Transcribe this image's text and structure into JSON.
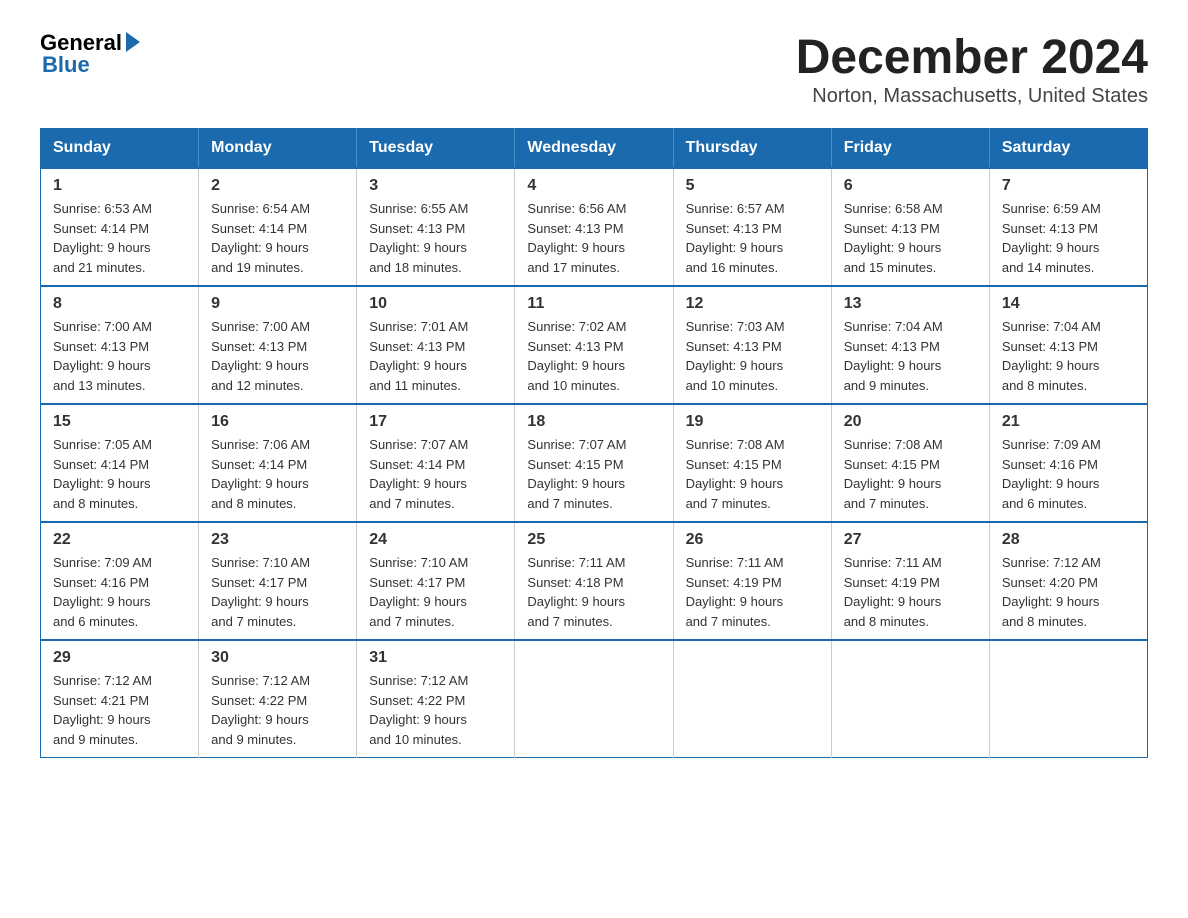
{
  "logo": {
    "general": "General",
    "blue": "Blue"
  },
  "title": "December 2024",
  "subtitle": "Norton, Massachusetts, United States",
  "weekdays": [
    "Sunday",
    "Monday",
    "Tuesday",
    "Wednesday",
    "Thursday",
    "Friday",
    "Saturday"
  ],
  "weeks": [
    [
      {
        "day": "1",
        "sunrise": "6:53 AM",
        "sunset": "4:14 PM",
        "daylight": "9 hours and 21 minutes."
      },
      {
        "day": "2",
        "sunrise": "6:54 AM",
        "sunset": "4:14 PM",
        "daylight": "9 hours and 19 minutes."
      },
      {
        "day": "3",
        "sunrise": "6:55 AM",
        "sunset": "4:13 PM",
        "daylight": "9 hours and 18 minutes."
      },
      {
        "day": "4",
        "sunrise": "6:56 AM",
        "sunset": "4:13 PM",
        "daylight": "9 hours and 17 minutes."
      },
      {
        "day": "5",
        "sunrise": "6:57 AM",
        "sunset": "4:13 PM",
        "daylight": "9 hours and 16 minutes."
      },
      {
        "day": "6",
        "sunrise": "6:58 AM",
        "sunset": "4:13 PM",
        "daylight": "9 hours and 15 minutes."
      },
      {
        "day": "7",
        "sunrise": "6:59 AM",
        "sunset": "4:13 PM",
        "daylight": "9 hours and 14 minutes."
      }
    ],
    [
      {
        "day": "8",
        "sunrise": "7:00 AM",
        "sunset": "4:13 PM",
        "daylight": "9 hours and 13 minutes."
      },
      {
        "day": "9",
        "sunrise": "7:00 AM",
        "sunset": "4:13 PM",
        "daylight": "9 hours and 12 minutes."
      },
      {
        "day": "10",
        "sunrise": "7:01 AM",
        "sunset": "4:13 PM",
        "daylight": "9 hours and 11 minutes."
      },
      {
        "day": "11",
        "sunrise": "7:02 AM",
        "sunset": "4:13 PM",
        "daylight": "9 hours and 10 minutes."
      },
      {
        "day": "12",
        "sunrise": "7:03 AM",
        "sunset": "4:13 PM",
        "daylight": "9 hours and 10 minutes."
      },
      {
        "day": "13",
        "sunrise": "7:04 AM",
        "sunset": "4:13 PM",
        "daylight": "9 hours and 9 minutes."
      },
      {
        "day": "14",
        "sunrise": "7:04 AM",
        "sunset": "4:13 PM",
        "daylight": "9 hours and 8 minutes."
      }
    ],
    [
      {
        "day": "15",
        "sunrise": "7:05 AM",
        "sunset": "4:14 PM",
        "daylight": "9 hours and 8 minutes."
      },
      {
        "day": "16",
        "sunrise": "7:06 AM",
        "sunset": "4:14 PM",
        "daylight": "9 hours and 8 minutes."
      },
      {
        "day": "17",
        "sunrise": "7:07 AM",
        "sunset": "4:14 PM",
        "daylight": "9 hours and 7 minutes."
      },
      {
        "day": "18",
        "sunrise": "7:07 AM",
        "sunset": "4:15 PM",
        "daylight": "9 hours and 7 minutes."
      },
      {
        "day": "19",
        "sunrise": "7:08 AM",
        "sunset": "4:15 PM",
        "daylight": "9 hours and 7 minutes."
      },
      {
        "day": "20",
        "sunrise": "7:08 AM",
        "sunset": "4:15 PM",
        "daylight": "9 hours and 7 minutes."
      },
      {
        "day": "21",
        "sunrise": "7:09 AM",
        "sunset": "4:16 PM",
        "daylight": "9 hours and 6 minutes."
      }
    ],
    [
      {
        "day": "22",
        "sunrise": "7:09 AM",
        "sunset": "4:16 PM",
        "daylight": "9 hours and 6 minutes."
      },
      {
        "day": "23",
        "sunrise": "7:10 AM",
        "sunset": "4:17 PM",
        "daylight": "9 hours and 7 minutes."
      },
      {
        "day": "24",
        "sunrise": "7:10 AM",
        "sunset": "4:17 PM",
        "daylight": "9 hours and 7 minutes."
      },
      {
        "day": "25",
        "sunrise": "7:11 AM",
        "sunset": "4:18 PM",
        "daylight": "9 hours and 7 minutes."
      },
      {
        "day": "26",
        "sunrise": "7:11 AM",
        "sunset": "4:19 PM",
        "daylight": "9 hours and 7 minutes."
      },
      {
        "day": "27",
        "sunrise": "7:11 AM",
        "sunset": "4:19 PM",
        "daylight": "9 hours and 8 minutes."
      },
      {
        "day": "28",
        "sunrise": "7:12 AM",
        "sunset": "4:20 PM",
        "daylight": "9 hours and 8 minutes."
      }
    ],
    [
      {
        "day": "29",
        "sunrise": "7:12 AM",
        "sunset": "4:21 PM",
        "daylight": "9 hours and 9 minutes."
      },
      {
        "day": "30",
        "sunrise": "7:12 AM",
        "sunset": "4:22 PM",
        "daylight": "9 hours and 9 minutes."
      },
      {
        "day": "31",
        "sunrise": "7:12 AM",
        "sunset": "4:22 PM",
        "daylight": "9 hours and 10 minutes."
      },
      null,
      null,
      null,
      null
    ]
  ]
}
